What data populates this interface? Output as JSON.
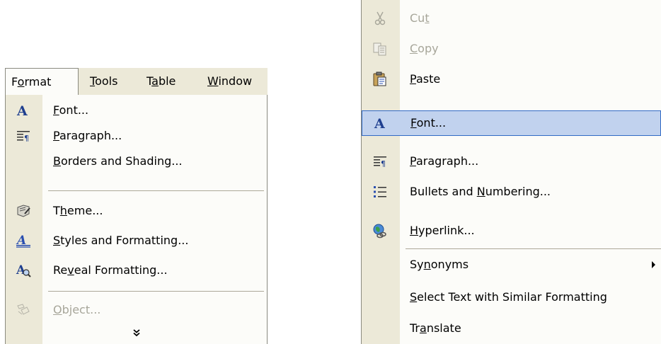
{
  "menubar": {
    "items": [
      {
        "pre": "F",
        "acc": "o",
        "post": "rmat"
      },
      {
        "pre": "",
        "acc": "T",
        "post": "ools"
      },
      {
        "pre": "T",
        "acc": "a",
        "post": "ble"
      },
      {
        "pre": "",
        "acc": "W",
        "post": "indow"
      }
    ]
  },
  "format_menu": {
    "items": [
      {
        "pre": "",
        "acc": "F",
        "post": "ont...",
        "icon": "font-icon"
      },
      {
        "pre": "",
        "acc": "P",
        "post": "aragraph...",
        "icon": "paragraph-icon"
      },
      {
        "pre": "",
        "acc": "B",
        "post": "orders and Shading...",
        "icon": ""
      },
      {
        "pre": "T",
        "acc": "h",
        "post": "eme...",
        "icon": "theme-icon"
      },
      {
        "pre": "",
        "acc": "S",
        "post": "tyles and Formatting...",
        "icon": "styles-icon"
      },
      {
        "pre": "Re",
        "acc": "v",
        "post": "eal Formatting...",
        "icon": "reveal-formatting-icon"
      },
      {
        "pre": "",
        "acc": "O",
        "post": "bject...",
        "icon": "object-icon"
      }
    ],
    "expand_icon": "double-chevron-down-icon"
  },
  "context_menu": {
    "items": [
      {
        "pre": "Cu",
        "acc": "t",
        "post": "",
        "icon": "scissors-icon"
      },
      {
        "pre": "",
        "acc": "C",
        "post": "opy",
        "icon": "copy-icon"
      },
      {
        "pre": "",
        "acc": "P",
        "post": "aste",
        "icon": "clipboard-icon"
      },
      {
        "pre": "",
        "acc": "F",
        "post": "ont...",
        "icon": "font-icon"
      },
      {
        "pre": "",
        "acc": "P",
        "post": "aragraph...",
        "icon": "paragraph-icon"
      },
      {
        "pre": "Bullets and ",
        "acc": "N",
        "post": "umbering...",
        "icon": "bullets-icon"
      },
      {
        "pre": "",
        "acc": "H",
        "post": "yperlink...",
        "icon": "hyperlink-globe-icon"
      },
      {
        "pre": "Sy",
        "acc": "n",
        "post": "onyms",
        "icon": ""
      },
      {
        "pre": "",
        "acc": "S",
        "post": "elect Text with Similar Formatting",
        "icon": ""
      },
      {
        "pre": "Tr",
        "acc": "a",
        "post": "nslate",
        "icon": ""
      }
    ],
    "submenu_arrow_icon": "submenu-arrow-icon"
  },
  "colors": {
    "highlight_bg": "#c1d2ee",
    "highlight_border": "#316ac5",
    "icon_column": "#ece9d8",
    "menu_bg": "#fcfcf9",
    "disabled_text": "#a7a69a"
  }
}
